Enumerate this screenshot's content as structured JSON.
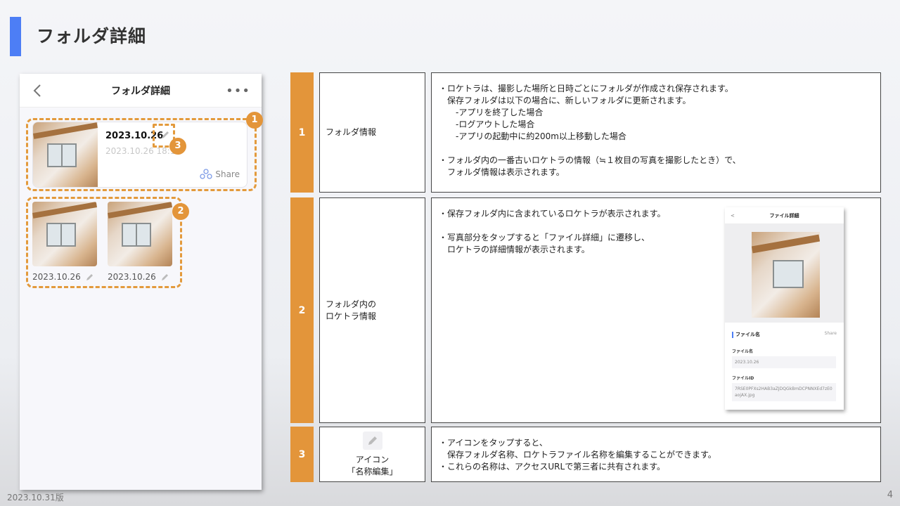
{
  "page": {
    "title": "フォルダ詳細",
    "version": "2023.10.31版",
    "page_number": "4",
    "accent": "#4d7ef5",
    "highlight": "#e3953a"
  },
  "phone": {
    "header_title": "フォルダ詳細",
    "back_icon": "chevron-left-icon",
    "more_icon": "more-dots-icon",
    "more_glyph": "•••",
    "folder": {
      "name": "2023.10.26",
      "date": "2023.10.26 18:1",
      "share_label": "Share"
    },
    "files": [
      {
        "date": "2023.10.26"
      },
      {
        "date": "2023.10.26"
      }
    ],
    "badges": [
      "1",
      "2",
      "3"
    ]
  },
  "table": {
    "rows": [
      {
        "num": "1",
        "label": "フォルダ情報",
        "desc": [
          "・ロケトラは、撮影した場所と日時ごとにフォルダが作成され保存されます。",
          "　保存フォルダは以下の場合に、新しいフォルダに更新されます。",
          "　　-アプリを終了した場合",
          "　　-ログアウトした場合",
          "　　-アプリの起動中に約200m以上移動した場合",
          "",
          "・フォルダ内の一番古いロケトラの情報（≒１枚目の写真を撮影したとき）で、",
          "　フォルダ情報は表示されます。"
        ]
      },
      {
        "num": "2",
        "label_lines": [
          "フォルダ内の",
          "ロケトラ情報"
        ],
        "desc": [
          "・保存フォルダ内に含まれているロケトラが表示されます。",
          "",
          "・写真部分をタップすると「ファイル詳細」に遷移し、",
          "　ロケトラの詳細情報が表示されます。"
        ]
      },
      {
        "num": "3",
        "label_lines": [
          "アイコン",
          "「名称編集」"
        ],
        "desc": [
          "・アイコンをタップすると、",
          "　保存フォルダ名称、ロケトラファイル名称を編集することができます。",
          "・これらの名称は、アクセスURLで第三者に共有されます。"
        ]
      }
    ]
  },
  "mini_screen": {
    "title": "ファイル詳細",
    "back": "<",
    "section": "ファイル名",
    "share": "Share",
    "file_name_label": "ファイル名",
    "file_name_value": "2023.10.26",
    "file_id_label": "ファイルID",
    "file_id_value": "7RSE0PFXs2HAB3aZJDQGkBmDCPNNXEd7zE0aojAX.jpg"
  }
}
